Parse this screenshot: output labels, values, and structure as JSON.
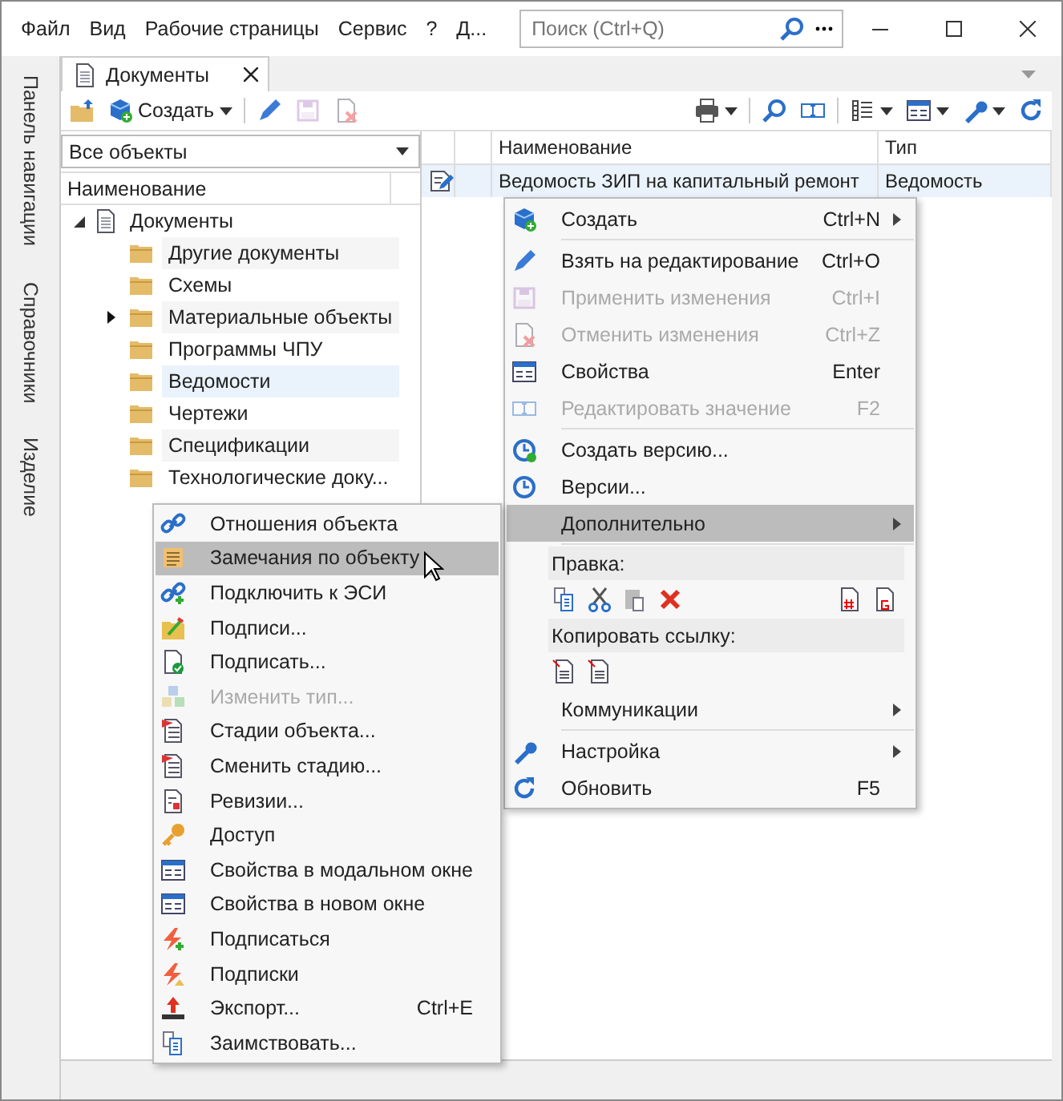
{
  "window": {
    "menu": [
      "Файл",
      "Вид",
      "Рабочие страницы",
      "Сервис",
      "?",
      "Д..."
    ],
    "search": {
      "placeholder": "Поиск (Ctrl+Q)"
    }
  },
  "nav_panel": [
    "Панель навигации",
    "Справочники",
    "Изделие"
  ],
  "tabs": [
    {
      "label": "Документы",
      "selected": true
    }
  ],
  "toolbar": {
    "create_label": "Создать"
  },
  "left_pane": {
    "filter": "Все объекты",
    "column": "Наименование",
    "tree": [
      {
        "label": "Документы",
        "expanded": true,
        "selected": false,
        "children": [
          {
            "label": "Другие документы",
            "kind": "leaf",
            "selected": false
          },
          {
            "label": "Схемы",
            "kind": "leaf",
            "selected": false
          },
          {
            "label": "Материальные объекты",
            "kind": "collapsed",
            "selected": false
          },
          {
            "label": "Программы ЧПУ",
            "kind": "leaf",
            "selected": false
          },
          {
            "label": "Ведомости",
            "kind": "leaf",
            "selected": true
          },
          {
            "label": "Чертежи",
            "kind": "leaf",
            "selected": false
          },
          {
            "label": "Спецификации",
            "kind": "leaf",
            "selected": false
          },
          {
            "label": "Технологические доку...",
            "kind": "leaf",
            "selected": false
          }
        ]
      }
    ]
  },
  "table": {
    "columns": [
      "Наименование",
      "Тип"
    ],
    "rows": [
      {
        "name": "Ведомость ЗИП на капитальный ремонт",
        "type": "Ведомость",
        "selected": true
      }
    ]
  },
  "context_menu": [
    {
      "kind": "item",
      "label": "Создать",
      "shortcut": "Ctrl+N",
      "submenu": true,
      "disabled": false,
      "selected": false
    },
    {
      "kind": "separator"
    },
    {
      "kind": "item",
      "label": "Взять на редактирование",
      "shortcut": "Ctrl+O",
      "submenu": false,
      "disabled": false,
      "selected": false
    },
    {
      "kind": "item",
      "label": "Применить изменения",
      "shortcut": "Ctrl+I",
      "submenu": false,
      "disabled": true,
      "selected": false
    },
    {
      "kind": "item",
      "label": "Отменить изменения",
      "shortcut": "Ctrl+Z",
      "submenu": false,
      "disabled": true,
      "selected": false
    },
    {
      "kind": "item",
      "label": "Свойства",
      "shortcut": "Enter",
      "submenu": false,
      "disabled": false,
      "selected": false
    },
    {
      "kind": "item",
      "label": "Редактировать значение",
      "shortcut": "F2",
      "submenu": false,
      "disabled": true,
      "selected": false
    },
    {
      "kind": "separator"
    },
    {
      "kind": "item",
      "label": "Создать версию...",
      "submenu": false,
      "disabled": false,
      "selected": false
    },
    {
      "kind": "item",
      "label": "Версии...",
      "submenu": false,
      "disabled": false,
      "selected": false
    },
    {
      "kind": "item",
      "label": "Дополнительно",
      "submenu": true,
      "disabled": false,
      "selected": true
    },
    {
      "kind": "separator"
    },
    {
      "kind": "section",
      "label": "Правка:"
    },
    {
      "kind": "edit-icons"
    },
    {
      "kind": "section",
      "label": "Копировать ссылку:"
    },
    {
      "kind": "link-icons"
    },
    {
      "kind": "item",
      "label": "Коммуникации",
      "submenu": true,
      "disabled": false,
      "selected": false
    },
    {
      "kind": "separator"
    },
    {
      "kind": "item",
      "label": "Настройка",
      "submenu": true,
      "disabled": false,
      "selected": false
    },
    {
      "kind": "item",
      "label": "Обновить",
      "shortcut": "F5",
      "submenu": false,
      "disabled": false,
      "selected": false
    }
  ],
  "submenu": [
    {
      "label": "Отношения объекта",
      "disabled": false,
      "selected": false
    },
    {
      "label": "Замечания по объекту",
      "disabled": false,
      "selected": true
    },
    {
      "label": "Подключить к ЭСИ",
      "disabled": false,
      "selected": false
    },
    {
      "label": "Подписи...",
      "disabled": false,
      "selected": false
    },
    {
      "label": "Подписать...",
      "disabled": false,
      "selected": false
    },
    {
      "label": "Изменить тип...",
      "disabled": true,
      "selected": false
    },
    {
      "label": "Стадии объекта...",
      "disabled": false,
      "selected": false
    },
    {
      "label": "Сменить стадию...",
      "disabled": false,
      "selected": false
    },
    {
      "label": "Ревизии...",
      "disabled": false,
      "selected": false
    },
    {
      "label": "Доступ",
      "disabled": false,
      "selected": false
    },
    {
      "label": "Свойства в модальном окне",
      "disabled": false,
      "selected": false
    },
    {
      "label": "Свойства в новом окне",
      "disabled": false,
      "selected": false
    },
    {
      "label": "Подписаться",
      "disabled": false,
      "selected": false
    },
    {
      "label": "Подписки",
      "disabled": false,
      "selected": false
    },
    {
      "label": "Экспорт...",
      "shortcut": "Ctrl+E",
      "disabled": false,
      "selected": false
    },
    {
      "label": "Заимствовать...",
      "disabled": false,
      "selected": false
    }
  ]
}
